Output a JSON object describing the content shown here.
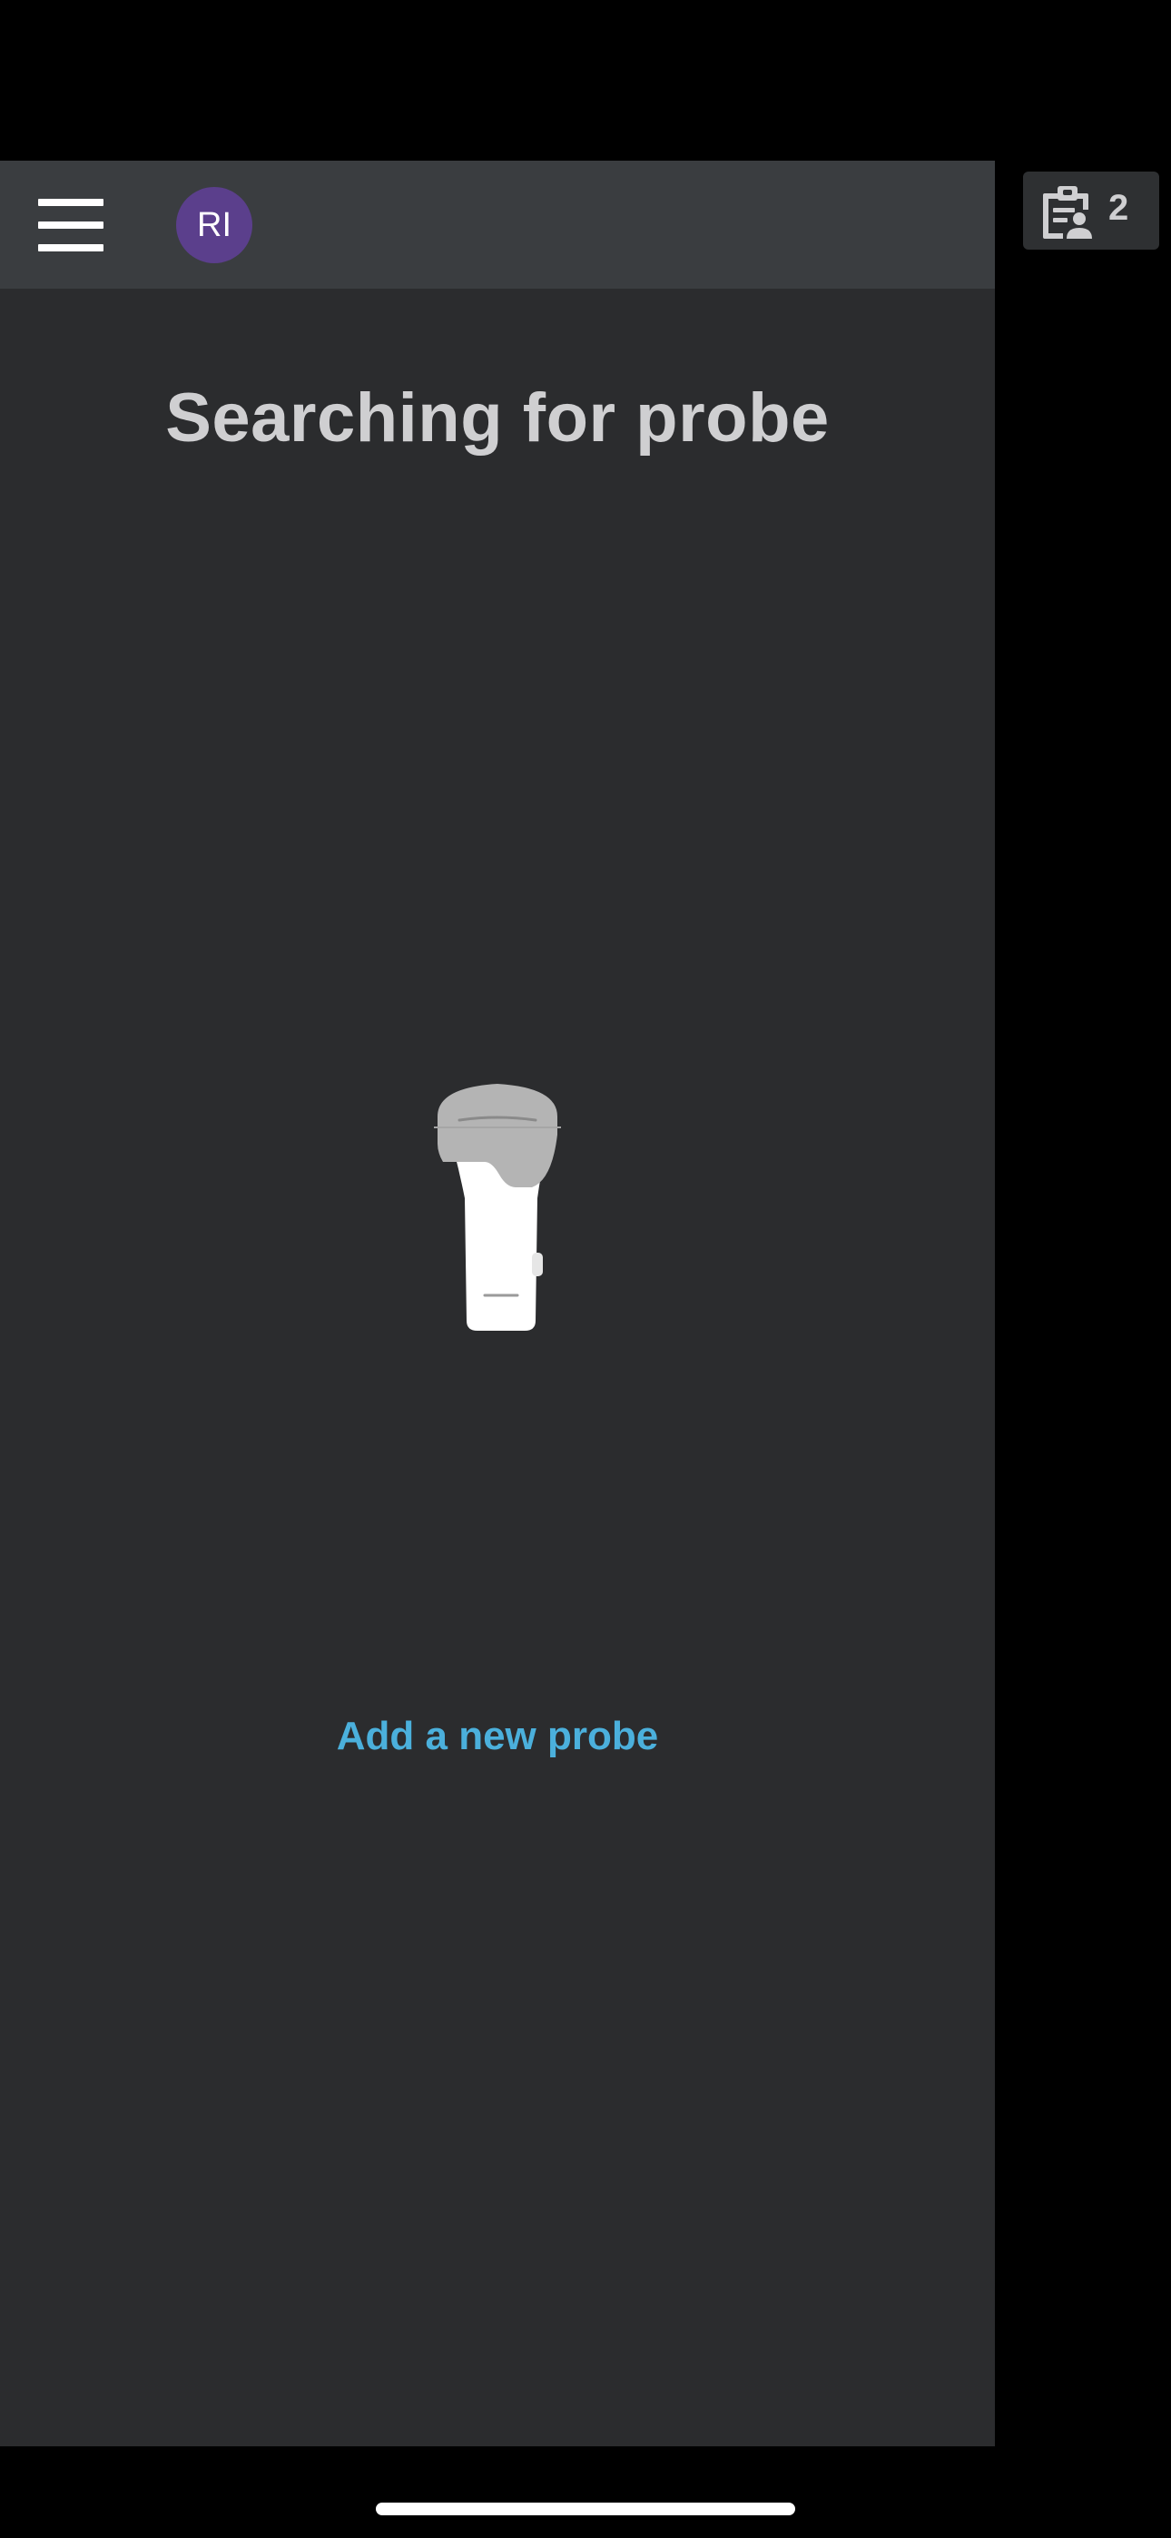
{
  "header": {
    "avatar_initials": "RI"
  },
  "main": {
    "title": "Searching for probe",
    "add_probe_label": "Add a new probe"
  },
  "worklist": {
    "count": "2"
  },
  "colors": {
    "background": "#000000",
    "panel": "#2b2c2e",
    "header": "#3a3d40",
    "avatar": "#5b3f8c",
    "link": "#4bb0dc",
    "title_text": "#cfcfd1"
  },
  "icons": {
    "menu": "hamburger-menu-icon",
    "worklist": "clipboard-patient-icon",
    "probe": "ultrasound-probe-icon"
  }
}
